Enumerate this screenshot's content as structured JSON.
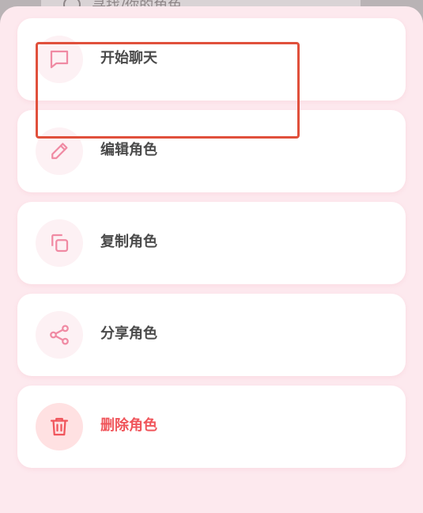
{
  "background": {
    "peek_text": "寻找/你的角色..."
  },
  "menu": {
    "items": [
      {
        "label": "开始聊天",
        "icon": "chat-bubble-icon"
      },
      {
        "label": "编辑角色",
        "icon": "pencil-icon"
      },
      {
        "label": "复制角色",
        "icon": "copy-icon"
      },
      {
        "label": "分享角色",
        "icon": "share-icon"
      },
      {
        "label": "删除角色",
        "icon": "trash-icon"
      }
    ]
  },
  "colors": {
    "accent_pink": "#f08aa3",
    "danger_red": "#f0555b",
    "sheet_bg": "#fde9ee",
    "highlight_box": "#e0503c"
  }
}
